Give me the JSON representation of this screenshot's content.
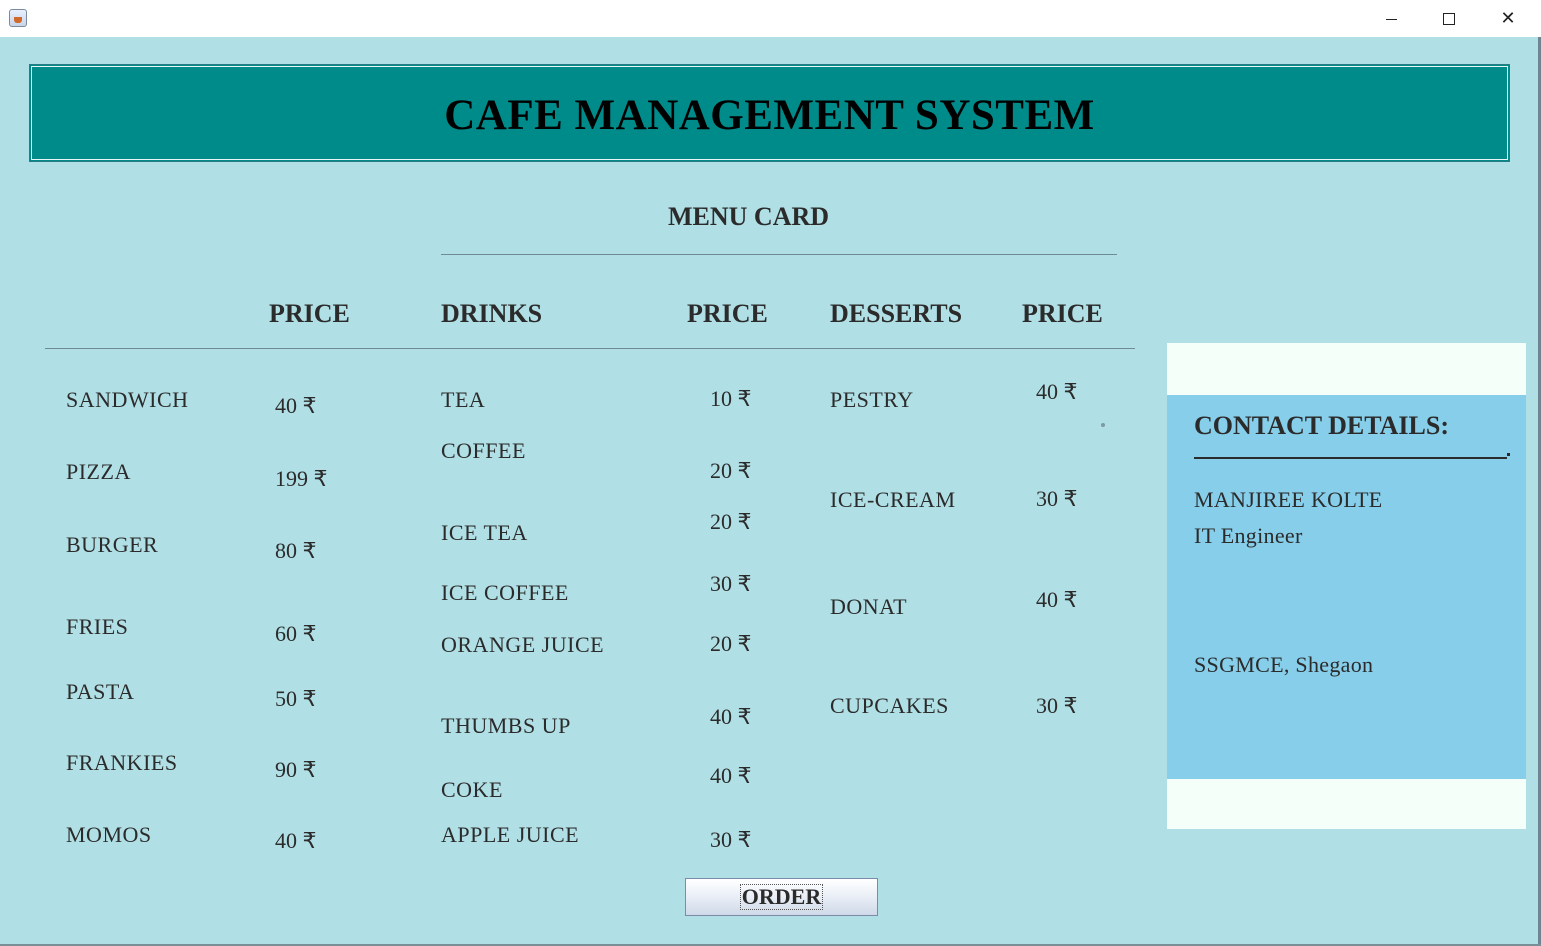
{
  "window": {
    "icon": "java-cup-icon",
    "controls": {
      "minimize_icon": "minimize-icon",
      "maximize_icon": "maximize-icon",
      "close_icon": "close-icon",
      "close_glyph": "✕"
    }
  },
  "header": {
    "title": "CAFE MANAGEMENT SYSTEM"
  },
  "menu": {
    "title": "MENU CARD",
    "columns": {
      "food_price": "PRICE",
      "drinks": "DRINKS",
      "drinks_price": "PRICE",
      "desserts": "DESSERTS",
      "desserts_price": "PRICE"
    },
    "food": [
      {
        "name": "SANDWICH",
        "price": "40 ₹"
      },
      {
        "name": "PIZZA",
        "price": "199 ₹"
      },
      {
        "name": "BURGER",
        "price": "80 ₹"
      },
      {
        "name": "FRIES",
        "price": "60 ₹"
      },
      {
        "name": "PASTA",
        "price": "50 ₹"
      },
      {
        "name": "FRANKIES",
        "price": "90 ₹"
      },
      {
        "name": "MOMOS",
        "price": "40 ₹"
      }
    ],
    "drinks": [
      {
        "name": "TEA",
        "price": "10 ₹"
      },
      {
        "name": "COFFEE",
        "price": "20 ₹"
      },
      {
        "name": "ICE TEA",
        "price": "20 ₹"
      },
      {
        "name": "ICE COFFEE",
        "price": "30 ₹"
      },
      {
        "name": "ORANGE JUICE",
        "price": "20 ₹"
      },
      {
        "name": "THUMBS UP",
        "price": "40 ₹"
      },
      {
        "name": "COKE",
        "price": "40 ₹"
      },
      {
        "name": "APPLE JUICE",
        "price": "30 ₹"
      }
    ],
    "desserts": [
      {
        "name": "PESTRY",
        "price": "40 ₹"
      },
      {
        "name": "ICE-CREAM",
        "price": "30 ₹"
      },
      {
        "name": "DONAT",
        "price": "40 ₹"
      },
      {
        "name": "CUPCAKES",
        "price": "30 ₹"
      }
    ]
  },
  "contact": {
    "title": "CONTACT DETAILS:",
    "name": "MANJIREE KOLTE",
    "role": "IT Engineer",
    "location": "SSGMCE, Shegaon"
  },
  "order_button": {
    "label": "ORDER"
  },
  "colors": {
    "background": "#b0dfe5",
    "header": "#008b8b",
    "contact_panel": "#87ceea",
    "contact_outer": "#f5fffa"
  }
}
